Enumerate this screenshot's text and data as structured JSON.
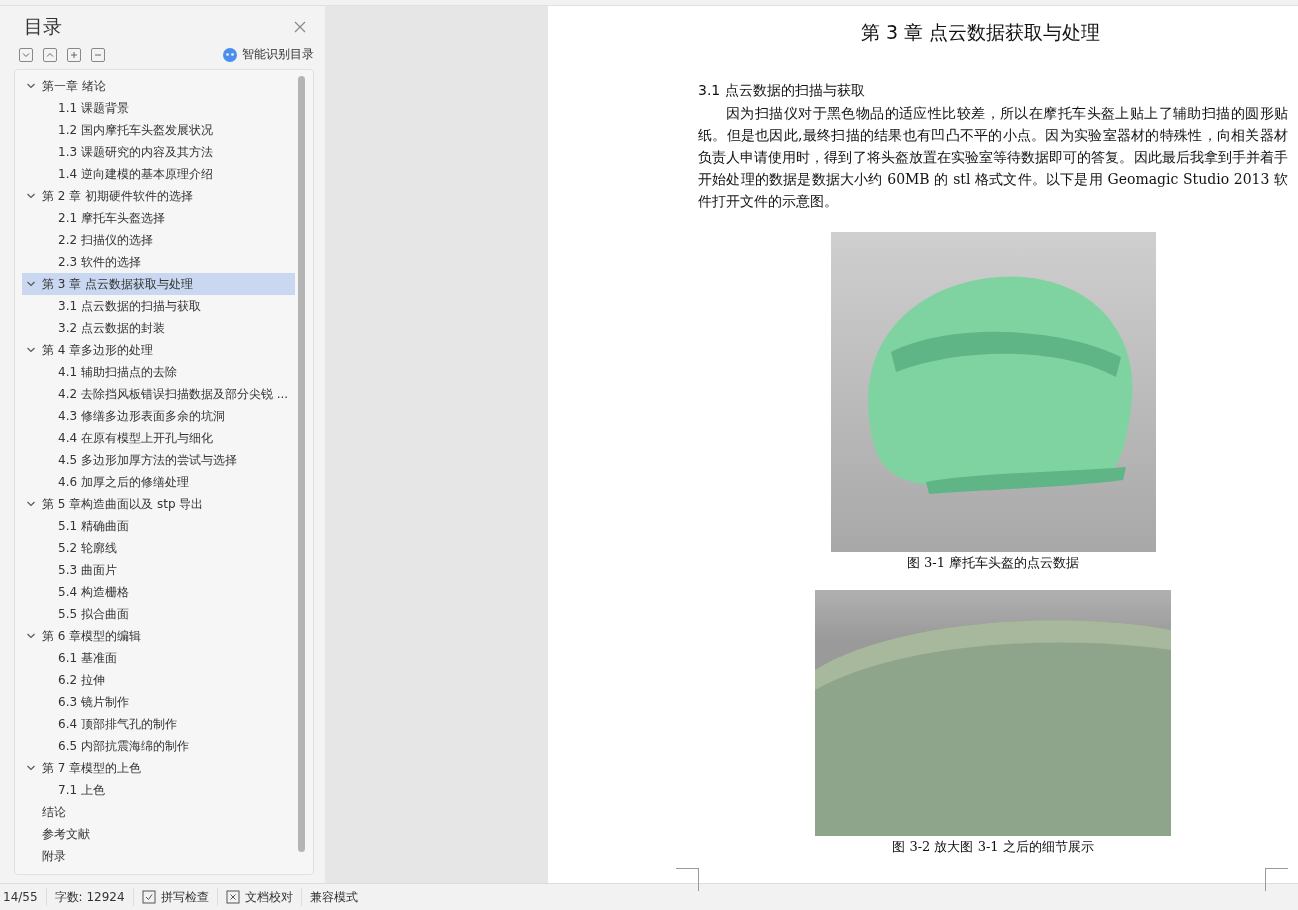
{
  "sidebar": {
    "title": "目录",
    "smart_button": "智能识别目录",
    "items": [
      {
        "label": "第一章  绪论",
        "expanded": true,
        "selected": false,
        "children": [
          {
            "label": "1.1 课题背景",
            "selected": false
          },
          {
            "label": "1.2 国内摩托车头盔发展状况",
            "selected": false
          },
          {
            "label": "1.3 课题研究的内容及其方法",
            "selected": false
          },
          {
            "label": "1.4 逆向建模的基本原理介绍",
            "selected": false
          }
        ]
      },
      {
        "label": "第 2 章  初期硬件软件的选择",
        "expanded": true,
        "selected": false,
        "children": [
          {
            "label": "2.1 摩托车头盔选择",
            "selected": false
          },
          {
            "label": "2.2 扫描仪的选择",
            "selected": false
          },
          {
            "label": "2.3  软件的选择",
            "selected": false
          }
        ]
      },
      {
        "label": "第 3 章    点云数据获取与处理",
        "expanded": true,
        "selected": true,
        "children": [
          {
            "label": "3.1  点云数据的扫描与获取",
            "selected": false
          },
          {
            "label": "3.2  点云数据的封装",
            "selected": false
          }
        ]
      },
      {
        "label": "第 4 章多边形的处理",
        "expanded": true,
        "selected": false,
        "children": [
          {
            "label": "4.1  辅助扫描点的去除",
            "selected": false
          },
          {
            "label": "4.2  去除挡风板错误扫描数据及部分尖锐 ...",
            "selected": false
          },
          {
            "label": "4.3  修缮多边形表面多余的坑洞",
            "selected": false
          },
          {
            "label": "4.4  在原有模型上开孔与细化",
            "selected": false
          },
          {
            "label": "4.5  多边形加厚方法的尝试与选择",
            "selected": false
          },
          {
            "label": "4.6  加厚之后的修缮处理",
            "selected": false
          }
        ]
      },
      {
        "label": "第 5 章构造曲面以及 stp 导出",
        "expanded": true,
        "selected": false,
        "children": [
          {
            "label": "5.1  精确曲面",
            "selected": false
          },
          {
            "label": "5.2  轮廓线",
            "selected": false
          },
          {
            "label": "5.3  曲面片",
            "selected": false
          },
          {
            "label": "5.4  构造栅格",
            "selected": false
          },
          {
            "label": "5.5  拟合曲面",
            "selected": false
          }
        ]
      },
      {
        "label": "第 6 章模型的编辑",
        "expanded": true,
        "selected": false,
        "children": [
          {
            "label": "6.1  基准面",
            "selected": false
          },
          {
            "label": "6.2  拉伸",
            "selected": false
          },
          {
            "label": "6.3  镜片制作",
            "selected": false
          },
          {
            "label": "6.4  顶部排气孔的制作",
            "selected": false
          },
          {
            "label": "6.5  内部抗震海绵的制作",
            "selected": false
          }
        ]
      },
      {
        "label": "第 7 章模型的上色",
        "expanded": true,
        "selected": false,
        "children": [
          {
            "label": "7.1  上色",
            "selected": false
          }
        ]
      },
      {
        "label": "结论",
        "selected": false
      },
      {
        "label": "参考文献",
        "selected": false
      },
      {
        "label": "附录",
        "selected": false
      }
    ]
  },
  "document": {
    "chapter_title": "第 3 章    点云数据获取与处理",
    "section_title": "3.1  点云数据的扫描与获取",
    "paragraph": "因为扫描仪对于黑色物品的适应性比较差，所以在摩托车头盔上贴上了辅助扫描的圆形贴纸。但是也因此,最终扫描的结果也有凹凸不平的小点。因为实验室器材的特殊性，向相关器材负责人申请使用时，得到了将头盔放置在实验室等待数据即可的答复。因此最后我拿到手并着手开始处理的数据是数据大小约 60MB 的 stl 格式文件。以下是用 Geomagic  Studio 2013 软件打开文件的示意图。",
    "figures": [
      {
        "kind": "full",
        "caption": "图 3-1 摩托车头盔的点云数据"
      },
      {
        "kind": "detail",
        "caption": "图 3-2 放大图 3-1 之后的细节展示"
      }
    ]
  },
  "status_bar": {
    "page": "14/55",
    "word_count": "字数: 12924",
    "spell_check": "拼写检查",
    "proofread": "文档校对",
    "mode": "兼容模式"
  }
}
